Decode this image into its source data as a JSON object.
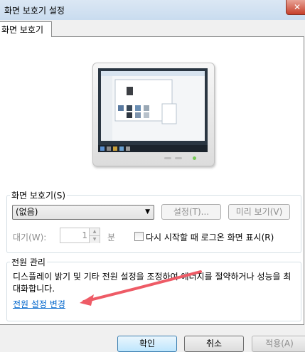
{
  "window": {
    "title": "화면 보호기 설정",
    "close_label": "✕"
  },
  "tab": {
    "label": "화면 보호기"
  },
  "screensaver": {
    "group_label": "화면 보호기(S)",
    "selected": "(없음)",
    "settings_button": "설정(T)...",
    "preview_button": "미리 보기(V)",
    "wait_label": "대기(W):",
    "wait_value": "1",
    "wait_unit": "분",
    "resume_label": "다시 시작할 때 로그온 화면 표시(R)",
    "resume_checked": false
  },
  "power": {
    "group_label": "전원 관리",
    "description": "디스플레이 밝기 및 기타 전원 설정을 조정하여 에너지를 절약하거나 성능을 최대화합니다.",
    "link": "전원 설정 변경"
  },
  "footer": {
    "ok": "확인",
    "cancel": "취소",
    "apply": "적용(A)"
  },
  "colors": {
    "accent": "#3c7fb1",
    "link": "#0066cc",
    "annotation_arrow": "#ee5b66"
  }
}
